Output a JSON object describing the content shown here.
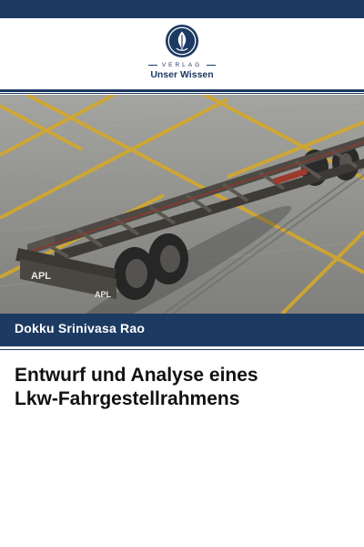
{
  "publisher": {
    "tagline": "VERLAG",
    "name": "Unser Wissen"
  },
  "cover_photo": {
    "trailer_markings": [
      "APL",
      "APL"
    ]
  },
  "book": {
    "author": "Dokku Srinivasa Rao",
    "title_line1": "Entwurf und Analyse eines",
    "title_line2": "Lkw-Fahrgestellrahmens"
  },
  "colors": {
    "brand_navy": "#1d3a63",
    "title_text": "#111111",
    "asphalt": "#8c8c88",
    "road_marking_yellow": "#d4a82c",
    "chassis": "#4d4944"
  }
}
